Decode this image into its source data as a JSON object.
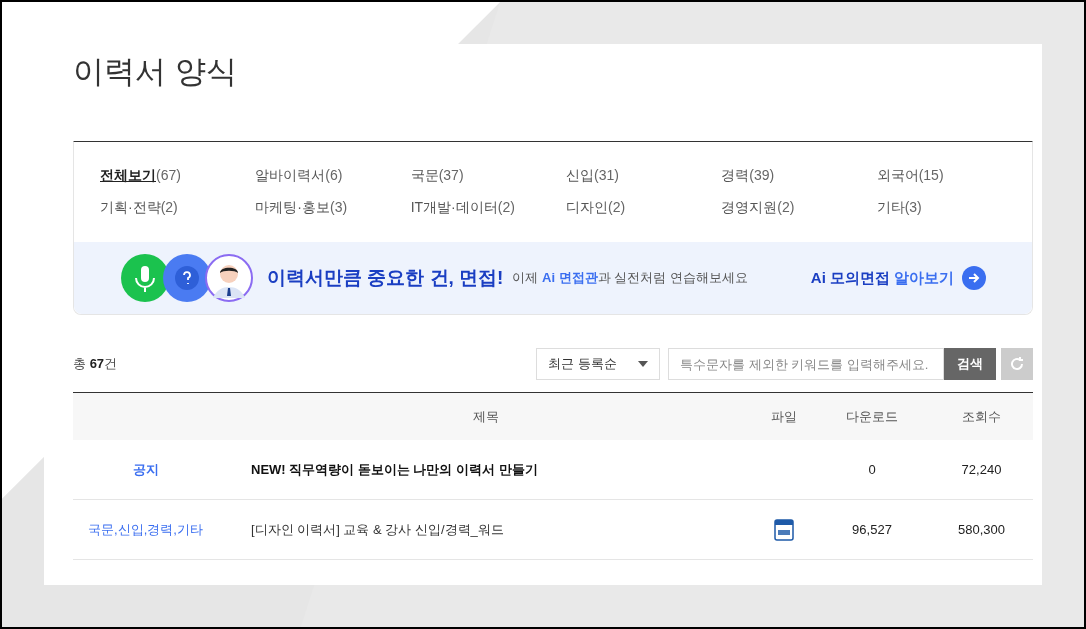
{
  "page_title": "이력서 양식",
  "categories": [
    {
      "label": "전체보기",
      "count": "(67)",
      "selected": true
    },
    {
      "label": "알바이력서",
      "count": "(6)",
      "selected": false
    },
    {
      "label": "국문",
      "count": "(37)",
      "selected": false
    },
    {
      "label": "신입",
      "count": "(31)",
      "selected": false
    },
    {
      "label": "경력",
      "count": "(39)",
      "selected": false
    },
    {
      "label": "외국어",
      "count": "(15)",
      "selected": false
    },
    {
      "label": "기획·전략",
      "count": "(2)",
      "selected": false
    },
    {
      "label": "마케팅·홍보",
      "count": "(3)",
      "selected": false
    },
    {
      "label": "IT개발·데이터",
      "count": "(2)",
      "selected": false
    },
    {
      "label": "디자인",
      "count": "(2)",
      "selected": false
    },
    {
      "label": "경영지원",
      "count": "(2)",
      "selected": false
    },
    {
      "label": "기타",
      "count": "(3)",
      "selected": false
    }
  ],
  "banner": {
    "headline": "이력서만큼 중요한 건, 면접!",
    "subtext": "이제 **Ai 면접관**과 실전처럼 연습해보세요",
    "link_strong": "Ai 모의면접",
    "link_light": "알아보기"
  },
  "total": {
    "prefix": "총",
    "count": "67",
    "suffix": "건"
  },
  "sort_select": {
    "value": "최근 등록순"
  },
  "search": {
    "placeholder": "특수문자를 제외한 키워드를 입력해주세요.",
    "button": "검색"
  },
  "table": {
    "columns": [
      "제목",
      "파일",
      "다운로드",
      "조회수"
    ],
    "rows": [
      {
        "kind": "notice",
        "category": "공지",
        "title": "NEW! 직무역량이 돋보이는 나만의 이력서 만들기",
        "has_file": false,
        "downloads": "0",
        "views": "72,240"
      },
      {
        "kind": "item",
        "category": "국문,신입,경력,기타",
        "title": "[디자인 이력서] 교육 & 강사 신입/경력_워드",
        "has_file": true,
        "downloads": "96,527",
        "views": "580,300"
      }
    ]
  }
}
